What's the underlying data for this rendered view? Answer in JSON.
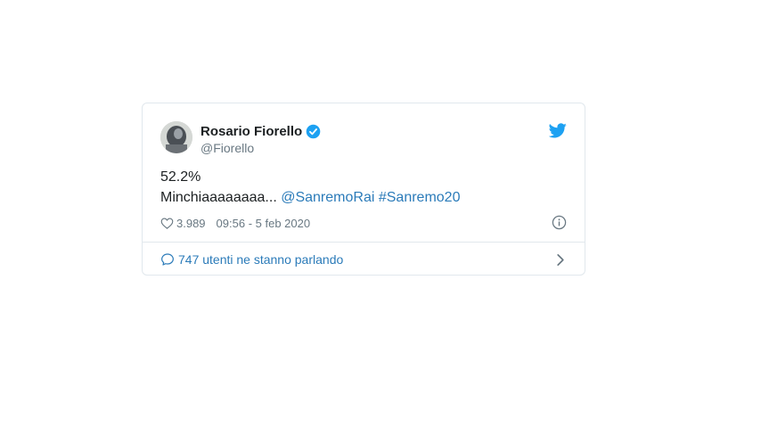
{
  "tweet": {
    "display_name": "Rosario Fiorello",
    "handle": "@Fiorello",
    "text_line1": "52.2%",
    "text_line2_plain": "Minchiaaaaaaaa...",
    "mention": "@SanremoRai",
    "hashtag": "#Sanremo20",
    "like_count": "3.989",
    "timestamp": "09:56 - 5 feb 2020",
    "conversation_label": "747 utenti ne stanno parlando"
  },
  "colors": {
    "brand_blue": "#1da1f2",
    "link_blue": "#2b7bb9",
    "text_dark": "#1c2022",
    "text_muted": "#697882",
    "border": "#e1e8ed"
  },
  "icons": {
    "avatar": "avatar",
    "verified": "verified-badge-icon",
    "brand": "twitter-bird-icon",
    "like": "heart-icon",
    "info": "info-icon",
    "conversation": "speech-bubble-icon",
    "chevron": "chevron-right-icon"
  }
}
